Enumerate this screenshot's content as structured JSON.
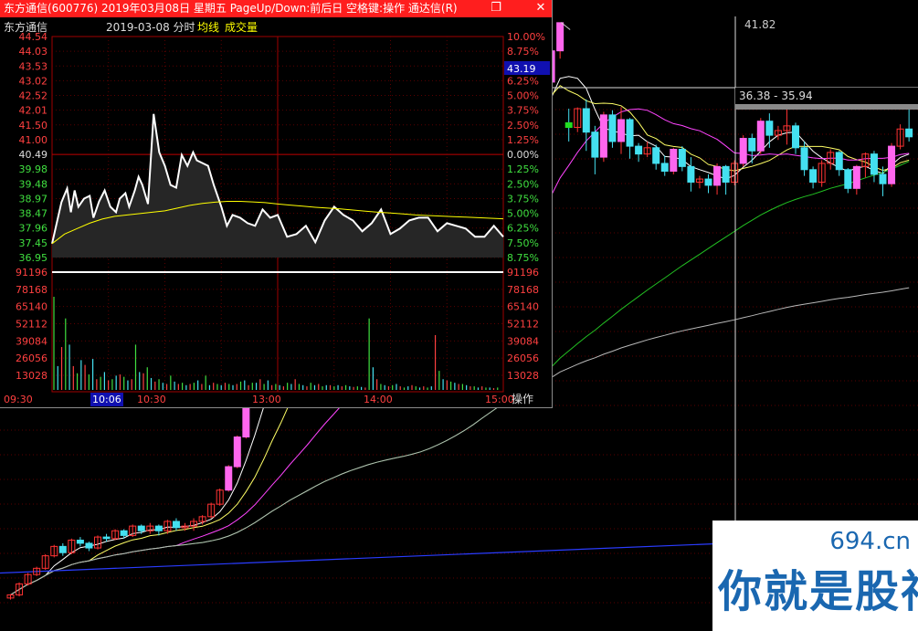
{
  "window": {
    "title": "东方通信(600776) 2019年03月08日 星期五 PageUp/Down:前后日 空格键:操作 通达信(R)",
    "restore_icon": "restore-icon",
    "close_icon": "close-icon"
  },
  "intraday": {
    "stock_name": "东方通信",
    "date_label": "2019-03-08 分时",
    "legend_avg": "均线",
    "legend_vol": "成交量",
    "legend_colors": {
      "avg": "#ffff00",
      "vol": "#ffff00",
      "price": "#ffffff"
    },
    "prev_close": "40.49",
    "current_price": "43.19",
    "operate_label": "操作",
    "time_labels": [
      "09:30",
      "10:06",
      "10:30",
      "13:00",
      "14:00",
      "15:00"
    ],
    "highlight_time": "10:06"
  },
  "chart_data": [
    {
      "type": "line",
      "title": "东方通信 2019-03-08 分时",
      "price_ticks_left": [
        "44.54",
        "44.03",
        "43.53",
        "43.02",
        "42.52",
        "42.01",
        "41.50",
        "41.00",
        "40.49",
        "39.98",
        "39.48",
        "38.97",
        "38.47",
        "37.96",
        "37.45",
        "36.95"
      ],
      "pct_ticks_right": [
        "10.00%",
        "8.75%",
        "7.50%",
        "6.25%",
        "5.00%",
        "3.75%",
        "2.50%",
        "1.25%",
        "0.00%",
        "1.25%",
        "2.50%",
        "3.75%",
        "5.00%",
        "6.25%",
        "7.50%",
        "8.75%"
      ],
      "ylim": [
        36.44,
        44.54
      ],
      "x_minutes": [
        0,
        5,
        8,
        10,
        12,
        14,
        17,
        20,
        22,
        25,
        28,
        31,
        34,
        36,
        39,
        41,
        44,
        46,
        48,
        51,
        54,
        57,
        60,
        63,
        66,
        69,
        72,
        75,
        77,
        80,
        83,
        86,
        90,
        93,
        96,
        100,
        104,
        108,
        112,
        116,
        120,
        125,
        130,
        135,
        140,
        145,
        150,
        155,
        160,
        165,
        170,
        175,
        180,
        185,
        190,
        195,
        200,
        205,
        210,
        215,
        220,
        225,
        230,
        235,
        240
      ],
      "series": [
        {
          "name": "price",
          "values": [
            36.95,
            38.47,
            38.97,
            38.1,
            38.9,
            38.3,
            38.6,
            38.7,
            37.9,
            38.5,
            38.9,
            38.3,
            38.1,
            38.6,
            38.8,
            38.3,
            38.9,
            39.4,
            39.1,
            38.4,
            41.7,
            40.3,
            39.8,
            39.1,
            39.0,
            40.2,
            39.8,
            40.3,
            40.0,
            39.9,
            39.8,
            39.1,
            38.3,
            37.6,
            38.0,
            37.9,
            37.7,
            37.6,
            38.2,
            37.9,
            38.0,
            37.2,
            37.3,
            37.6,
            37.0,
            37.8,
            38.3,
            38.0,
            37.8,
            37.4,
            37.7,
            38.2,
            37.3,
            37.5,
            37.8,
            37.9,
            37.9,
            37.4,
            37.7,
            37.6,
            37.5,
            37.2,
            37.2,
            37.6,
            37.2
          ]
        },
        {
          "name": "average",
          "values": [
            36.95,
            37.3,
            37.5,
            37.7,
            37.85,
            37.95,
            38.0,
            38.05,
            38.1,
            38.15,
            38.25,
            38.35,
            38.42,
            38.47,
            38.5,
            38.5,
            38.48,
            38.45,
            38.4,
            38.36,
            38.32,
            38.28,
            38.25,
            38.22,
            38.18,
            38.14,
            38.1,
            38.07,
            38.04,
            38.0,
            37.98,
            37.96,
            37.94,
            37.92,
            37.9,
            37.88,
            37.86
          ]
        }
      ]
    },
    {
      "type": "bar",
      "title": "成交量",
      "vol_ticks": [
        "91196",
        "78168",
        "65140",
        "52112",
        "39084",
        "26056",
        "13028"
      ],
      "ylim": [
        0,
        91196
      ],
      "values": [
        78168,
        20000,
        36000,
        60000,
        38000,
        20000,
        14000,
        25000,
        21000,
        13000,
        26000,
        9000,
        11000,
        15000,
        8000,
        9000,
        12000,
        13000,
        11000,
        8000,
        9000,
        38000,
        15000,
        14000,
        19000,
        10000,
        7000,
        9000,
        6000,
        5000,
        12000,
        7000,
        5000,
        6000,
        4000,
        5000,
        6000,
        8000,
        5000,
        12000,
        4000,
        6000,
        5000,
        4000,
        6000,
        5000,
        4000,
        5000,
        7000,
        8000,
        4000,
        6000,
        6000,
        9000,
        5000,
        8000,
        4000,
        5000,
        4000,
        3000,
        6000,
        5000,
        9000,
        5000,
        4000,
        3000,
        6000,
        4000,
        5000,
        3000,
        4000,
        4000,
        3000,
        4000,
        3000,
        4000,
        3000,
        2500,
        3000,
        2500,
        2000,
        60000,
        19000,
        9000,
        5000,
        4000,
        3000,
        4000,
        5000,
        3000,
        2000,
        3000,
        4000,
        3000,
        2000,
        3000,
        2000,
        3000,
        46000,
        16000,
        9000,
        8000,
        7000,
        6000,
        5000,
        5000,
        4000,
        3000,
        3000,
        2000,
        3000,
        2000,
        2000,
        1500,
        2000
      ]
    },
    {
      "type": "bar",
      "title": "东方通信 日K线",
      "annotations": {
        "high_label": "41.82",
        "range_label": "36.38 - 35.94"
      },
      "candles": [
        [
          5.0,
          5.2,
          4.9,
          5.25
        ],
        [
          5.2,
          5.9,
          5.1,
          6.0
        ],
        [
          5.9,
          6.5,
          5.8,
          6.6
        ],
        [
          6.5,
          6.9,
          6.4,
          7.0
        ],
        [
          6.9,
          7.7,
          6.8,
          7.8
        ],
        [
          7.7,
          8.3,
          7.6,
          8.4
        ],
        [
          8.3,
          7.9,
          7.7,
          8.5
        ],
        [
          7.9,
          8.7,
          7.8,
          8.8
        ],
        [
          8.7,
          8.5,
          8.3,
          8.9
        ],
        [
          8.5,
          8.2,
          8.0,
          8.6
        ],
        [
          8.2,
          8.9,
          8.1,
          9.0
        ],
        [
          8.9,
          8.8,
          8.6,
          9.1
        ],
        [
          8.8,
          9.3,
          8.7,
          9.4
        ],
        [
          9.3,
          9.0,
          8.8,
          9.4
        ],
        [
          9.0,
          9.6,
          8.9,
          9.7
        ],
        [
          9.6,
          9.3,
          9.1,
          9.7
        ],
        [
          9.3,
          9.6,
          9.1,
          9.8
        ],
        [
          9.6,
          9.3,
          9.0,
          9.7
        ],
        [
          9.3,
          9.9,
          9.1,
          10.0
        ],
        [
          9.9,
          9.5,
          9.3,
          10.1
        ],
        [
          9.5,
          9.6,
          9.3,
          9.8
        ],
        [
          9.6,
          9.9,
          9.3,
          10.1
        ],
        [
          9.9,
          10.2,
          9.7,
          10.3
        ],
        [
          10.2,
          11.0,
          10.1,
          11.1
        ],
        [
          11.0,
          11.9,
          10.9,
          12.0
        ],
        [
          11.9,
          13.4,
          11.8,
          13.5
        ],
        [
          13.4,
          15.3,
          13.3,
          15.4
        ],
        [
          15.3,
          17.4,
          15.2,
          17.5
        ],
        [
          17.4,
          19.0,
          17.2,
          19.2
        ],
        [
          19.0,
          20.8,
          18.9,
          20.9
        ],
        [
          20.8,
          21.8,
          20.6,
          22.0
        ],
        [
          21.8,
          21.3,
          20.9,
          22.3
        ],
        [
          21.3,
          22.6,
          21.1,
          22.8
        ],
        [
          22.6,
          21.6,
          21.1,
          23.5
        ],
        [
          21.6,
          22.1,
          21.4,
          22.4
        ],
        [
          22.1,
          23.0,
          21.9,
          23.1
        ],
        [
          23.0,
          22.8,
          22.0,
          23.4
        ],
        [
          22.8,
          21.5,
          21.1,
          23.0
        ],
        [
          21.5,
          22.3,
          21.2,
          22.6
        ],
        [
          22.3,
          21.5,
          21.2,
          22.5
        ],
        [
          21.5,
          20.9,
          20.6,
          21.7
        ],
        [
          20.9,
          21.2,
          20.2,
          21.4
        ],
        [
          21.2,
          20.4,
          20.1,
          21.3
        ],
        [
          20.4,
          19.6,
          19.3,
          20.5
        ],
        [
          19.6,
          19.1,
          18.8,
          19.7
        ],
        [
          19.1,
          19.5,
          18.7,
          19.6
        ],
        [
          19.5,
          20.2,
          19.3,
          20.3
        ],
        [
          20.2,
          21.8,
          20.1,
          22.0
        ],
        [
          21.8,
          24.4,
          21.7,
          24.5
        ],
        [
          24.4,
          26.8,
          24.3,
          27.0
        ],
        [
          26.8,
          28.8,
          26.6,
          29.0
        ],
        [
          28.8,
          31.0,
          28.7,
          31.1
        ],
        [
          31.0,
          32.5,
          30.6,
          33.0
        ],
        [
          32.5,
          35.6,
          32.3,
          35.7
        ],
        [
          35.6,
          38.4,
          35.5,
          38.5
        ],
        [
          38.4,
          38.8,
          37.9,
          38.9
        ],
        [
          38.8,
          38.6,
          38.3,
          38.9
        ],
        [
          38.6,
          35.1,
          35.0,
          38.8
        ],
        [
          35.1,
          35.6,
          34.9,
          35.8
        ],
        [
          35.6,
          34.5,
          34.0,
          35.8
        ],
        [
          34.5,
          36.9,
          34.4,
          37.0
        ],
        [
          36.9,
          38.0,
          36.5,
          38.1
        ],
        [
          38.0,
          40.0,
          37.8,
          40.1
        ],
        [
          40.0,
          41.8,
          39.5,
          41.82
        ],
        [
          35.4,
          35.1,
          34.2,
          36.3
        ],
        [
          35.1,
          36.3,
          34.8,
          36.38
        ],
        [
          36.3,
          34.8,
          33.6,
          36.9
        ],
        [
          34.8,
          33.2,
          32.1,
          35.2
        ],
        [
          33.2,
          35.9,
          32.9,
          36.1
        ],
        [
          35.9,
          34.2,
          33.8,
          36.2
        ],
        [
          34.2,
          35.6,
          33.4,
          36.4
        ],
        [
          35.6,
          33.9,
          33.1,
          35.7
        ],
        [
          33.9,
          33.4,
          32.9,
          34.1
        ],
        [
          33.4,
          33.8,
          33.2,
          34.2
        ],
        [
          33.8,
          32.8,
          32.4,
          34.0
        ],
        [
          32.8,
          32.3,
          32.0,
          33.3
        ],
        [
          32.3,
          33.7,
          32.1,
          33.8
        ],
        [
          33.7,
          32.6,
          32.3,
          33.9
        ],
        [
          32.6,
          31.6,
          31.0,
          33.2
        ],
        [
          31.6,
          31.8,
          31.2,
          32.0
        ],
        [
          31.8,
          31.4,
          30.9,
          32.1
        ],
        [
          31.4,
          32.6,
          30.8,
          32.8
        ],
        [
          32.6,
          31.6,
          30.8,
          32.7
        ],
        [
          31.6,
          32.8,
          31.4,
          33.0
        ],
        [
          32.8,
          34.4,
          32.6,
          34.6
        ],
        [
          34.4,
          33.6,
          32.8,
          34.7
        ],
        [
          33.6,
          35.5,
          33.4,
          35.7
        ],
        [
          35.5,
          34.6,
          33.8,
          36.0
        ],
        [
          34.6,
          34.9,
          34.3,
          35.2
        ],
        [
          34.9,
          35.2,
          34.0,
          36.3
        ],
        [
          35.2,
          33.8,
          33.4,
          35.4
        ],
        [
          33.8,
          32.4,
          32.0,
          34.2
        ],
        [
          32.4,
          31.6,
          31.2,
          32.6
        ],
        [
          31.6,
          32.8,
          31.3,
          33.0
        ],
        [
          32.8,
          33.5,
          32.4,
          33.7
        ],
        [
          33.5,
          32.4,
          32.0,
          33.6
        ],
        [
          32.4,
          31.2,
          30.9,
          32.5
        ],
        [
          31.2,
          32.6,
          30.8,
          32.7
        ],
        [
          32.6,
          33.4,
          31.9,
          33.5
        ],
        [
          33.4,
          32.1,
          31.6,
          33.6
        ],
        [
          32.1,
          31.5,
          30.7,
          32.6
        ],
        [
          31.5,
          33.9,
          31.3,
          34.1
        ],
        [
          33.9,
          35.0,
          33.7,
          35.3
        ],
        [
          35.0,
          34.5,
          34.2,
          36.5
        ]
      ],
      "ylim": [
        4.7,
        42.2
      ]
    }
  ]
}
